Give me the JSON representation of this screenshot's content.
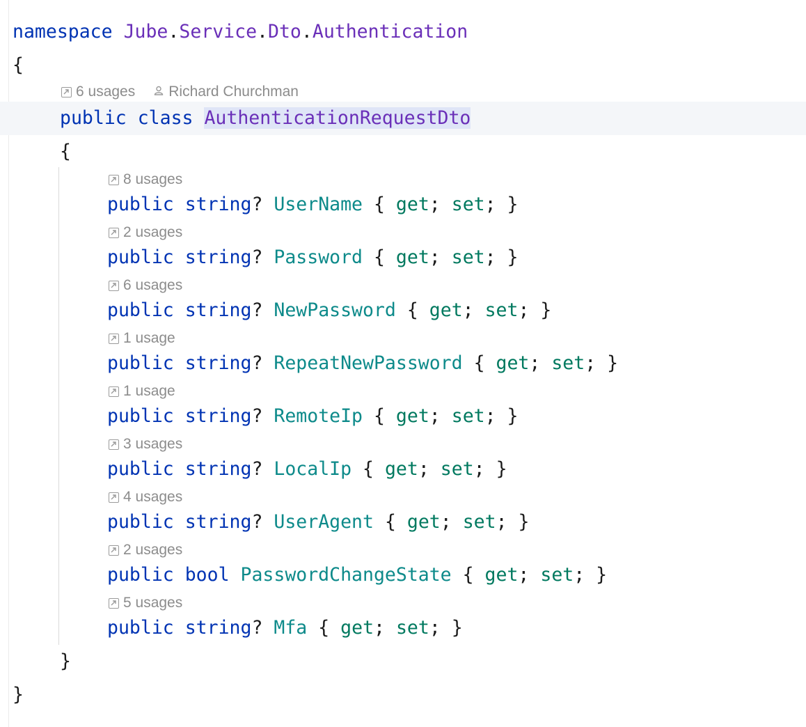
{
  "namespace_line": {
    "keyword": "namespace",
    "parts": [
      "Jube",
      ".",
      "Service",
      ".",
      "Dto",
      ".",
      "Authentication"
    ]
  },
  "braces": {
    "open": "{",
    "close": "}"
  },
  "class_hint": {
    "usages": "6 usages",
    "author": "Richard Churchman"
  },
  "class_decl": {
    "modifier": "public",
    "keyword": "class",
    "name": "AuthenticationRequestDto"
  },
  "properties": [
    {
      "usages": "8 usages",
      "modifier": "public",
      "type": "string",
      "nullable": "?",
      "name": "UserName"
    },
    {
      "usages": "2 usages",
      "modifier": "public",
      "type": "string",
      "nullable": "?",
      "name": "Password"
    },
    {
      "usages": "6 usages",
      "modifier": "public",
      "type": "string",
      "nullable": "?",
      "name": "NewPassword"
    },
    {
      "usages": "1 usage",
      "modifier": "public",
      "type": "string",
      "nullable": "?",
      "name": "RepeatNewPassword"
    },
    {
      "usages": "1 usage",
      "modifier": "public",
      "type": "string",
      "nullable": "?",
      "name": "RemoteIp"
    },
    {
      "usages": "3 usages",
      "modifier": "public",
      "type": "string",
      "nullable": "?",
      "name": "LocalIp"
    },
    {
      "usages": "4 usages",
      "modifier": "public",
      "type": "string",
      "nullable": "?",
      "name": "UserAgent"
    },
    {
      "usages": "2 usages",
      "modifier": "public",
      "type": "bool",
      "nullable": "",
      "name": "PasswordChangeState"
    },
    {
      "usages": "5 usages",
      "modifier": "public",
      "type": "string",
      "nullable": "?",
      "name": "Mfa"
    }
  ],
  "accessors": {
    "open": "{",
    "get": "get",
    "semi": ";",
    "set": "set",
    "close": "}"
  },
  "icons": {
    "usage_icon": "go-to-usages-icon",
    "author_icon": "person-icon"
  },
  "colors": {
    "keyword": "#0033b3",
    "type_name": "#6a2fb8",
    "property": "#0d8a8a",
    "accessor": "#00795f",
    "hint": "#8c8c8c",
    "class_highlight": "#dfe5f7"
  }
}
